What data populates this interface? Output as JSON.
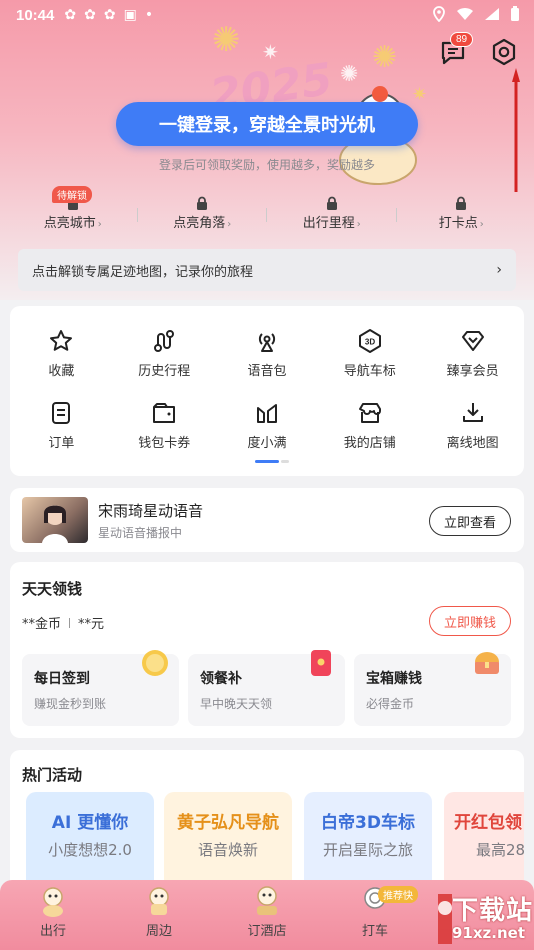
{
  "status_bar": {
    "time": "10:44",
    "notif_icons": [
      "cloud-icon",
      "cloud-icon",
      "cloud-icon",
      "sim-icon"
    ],
    "dot": "•"
  },
  "header": {
    "message_badge": "89"
  },
  "hero": {
    "login_button": "一键登录，穿越全景时光机",
    "login_hint": "登录后可领取奖励，使用越多，奖励越多"
  },
  "features": [
    {
      "label": "点亮城市",
      "badge": "待解锁"
    },
    {
      "label": "点亮角落"
    },
    {
      "label": "出行里程"
    },
    {
      "label": "打卡点"
    }
  ],
  "footprint_banner": {
    "text": "点击解锁专属足迹地图，记录你的旅程"
  },
  "grid": {
    "items": [
      {
        "label": "收藏",
        "icon": "star-icon"
      },
      {
        "label": "历史行程",
        "icon": "route-icon"
      },
      {
        "label": "语音包",
        "icon": "broadcast-icon"
      },
      {
        "label": "导航车标",
        "icon": "3d-icon"
      },
      {
        "label": "臻享会员",
        "icon": "diamond-icon"
      },
      {
        "label": "订单",
        "icon": "order-icon"
      },
      {
        "label": "钱包卡券",
        "icon": "wallet-icon"
      },
      {
        "label": "度小满",
        "icon": "leaf-icon"
      },
      {
        "label": "我的店铺",
        "icon": "store-icon"
      },
      {
        "label": "离线地图",
        "icon": "download-icon"
      }
    ]
  },
  "voice_card": {
    "title": "宋雨琦星动语音",
    "subtitle": "星动语音播报中",
    "button": "立即查看"
  },
  "earn": {
    "title": "天天领钱",
    "coins": "**金币",
    "cash": "**元",
    "button": "立即赚钱",
    "tasks": [
      {
        "title": "每日签到",
        "subtitle": "赚现金秒到账"
      },
      {
        "title": "领餐补",
        "subtitle": "早中晚天天领"
      },
      {
        "title": "宝箱赚钱",
        "subtitle": "必得金币"
      }
    ]
  },
  "hot": {
    "title": "热门活动",
    "tiles": [
      {
        "title": "AI 更懂你",
        "subtitle": "小度想想2.0",
        "title_color": "#3b6fd8",
        "bg": "#dcecff"
      },
      {
        "title": "黄子弘凡导航",
        "subtitle": "语音焕新",
        "title_color": "#e5901a",
        "bg": "#fff3df"
      },
      {
        "title": "白帝3D车标",
        "subtitle": "开启星际之旅",
        "title_color": "#3b6fd8",
        "bg": "#e6efff"
      },
      {
        "title": "开红包领",
        "subtitle": "最高28",
        "title_color": "#e0463c",
        "bg": "#ffe7e4"
      }
    ]
  },
  "tabbar": {
    "items": [
      {
        "label": "出行"
      },
      {
        "label": "周边"
      },
      {
        "label": "订酒店"
      },
      {
        "label": "打车"
      }
    ],
    "badge": "推荐快"
  },
  "watermark": {
    "cn": "下载站",
    "url": "91xz.net"
  }
}
